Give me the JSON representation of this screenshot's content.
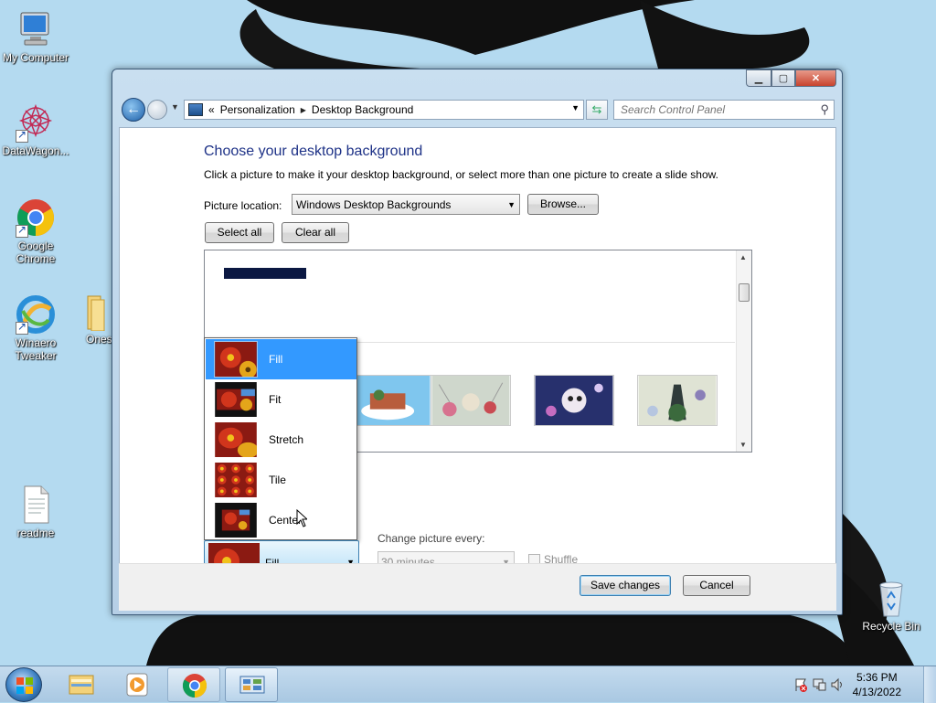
{
  "desktop": {
    "icons": [
      {
        "label": "My Computer"
      },
      {
        "label": "DataWagon..."
      },
      {
        "label": "Google Chrome"
      },
      {
        "label": "Winaero Tweaker"
      },
      {
        "label": "Ones"
      },
      {
        "label": "readme"
      },
      {
        "label": "Recycle Bin"
      }
    ]
  },
  "window": {
    "controls": {
      "minimize_icon": "minimize-icon",
      "maximize_icon": "maximize-icon",
      "close_icon": "close-icon"
    },
    "nav": {
      "breadcrumb_overflow": "«",
      "crumbs": [
        "Personalization",
        "Desktop Background"
      ],
      "search_placeholder": "Search Control Panel"
    },
    "title": "Choose your desktop background",
    "subtitle": "Click a picture to make it your desktop background, or select more than one picture to create a slide show.",
    "picture_location": {
      "label": "Picture location:",
      "value": "Windows Desktop Backgrounds"
    },
    "browse_label": "Browse...",
    "select_all_label": "Select all",
    "clear_all_label": "Clear all",
    "position_dropdown": {
      "options": [
        "Fill",
        "Fit",
        "Stretch",
        "Tile",
        "Center"
      ],
      "selected_index": 0,
      "current": "Fill"
    },
    "slideshow": {
      "change_label": "Change picture every:",
      "interval": "30 minutes",
      "shuffle_label": "Shuffle",
      "shuffle_checked": false
    },
    "save_label": "Save changes",
    "cancel_label": "Cancel"
  },
  "taskbar": {
    "clock_time": "5:36 PM",
    "clock_date": "4/13/2022"
  },
  "colors": {
    "accent": "#3399ff",
    "title_blue": "#1e3287",
    "desktop_bg": "#b4daf0"
  }
}
